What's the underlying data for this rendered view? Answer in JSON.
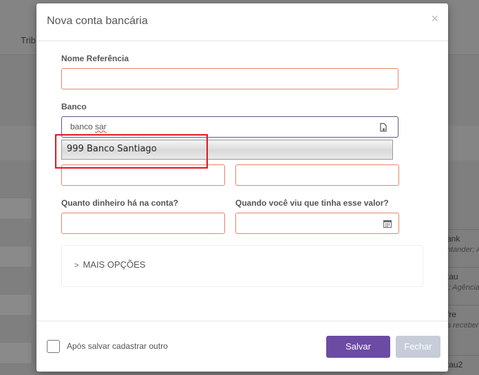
{
  "background": {
    "tab_label": "Trib",
    "cards": [
      {
        "title": "ank",
        "subtitle": "ntander; A"
      },
      {
        "title": "tau",
        "subtitle": "i; Agência"
      },
      {
        "title": "fre",
        "subtitle": "a receber"
      },
      {
        "title": "tau2",
        "subtitle": ""
      }
    ]
  },
  "modal": {
    "title": "Nova conta bancária",
    "close_glyph": "×",
    "fields": {
      "nome_referencia_label": "Nome Referência",
      "nome_referencia_value": "",
      "banco_label": "Banco",
      "banco_value_prefix": "banco ",
      "banco_value_typo": "sar",
      "agencia_value": "",
      "conta_value": "",
      "quanto_label": "Quanto dinheiro há na conta?",
      "quanto_value": "",
      "quando_label": "Quando você viu que tinha esse valor?",
      "quando_value": ""
    },
    "autocomplete_option": "999 Banco Santiago",
    "more_options": "MAIS OPÇÕES",
    "footer": {
      "checkbox_label": "Após salvar cadastrar outro",
      "save_label": "Salvar",
      "close_label": "Fechar"
    }
  },
  "colors": {
    "primary": "#6b4ba4",
    "invalid_border": "#e8836b",
    "focus_border": "#5c5880",
    "annotation": "#e0141e"
  }
}
